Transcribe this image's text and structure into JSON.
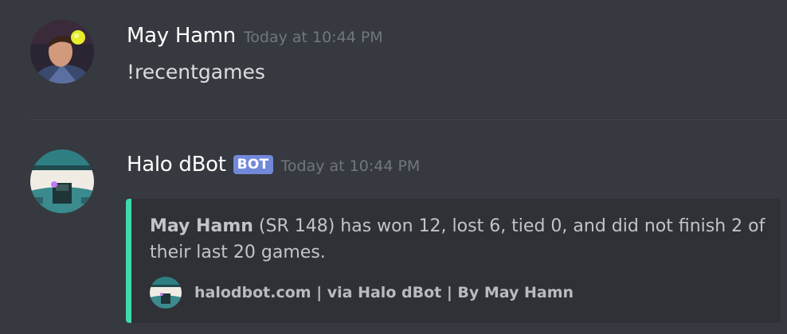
{
  "messages": [
    {
      "author": "May Hamn",
      "timestamp": "Today at 10:44 PM",
      "text": "!recentgames"
    },
    {
      "author": "Halo dBot",
      "badge": "BOT",
      "timestamp": "Today at 10:44 PM",
      "embed": {
        "accent_color": "#3fd9ae",
        "player": "May Hamn",
        "description": " (SR 148) has won 12, lost 6, tied 0, and did not finish 2 of their last 20 games.",
        "footer": "halodbot.com | via Halo dBot | By May Hamn"
      }
    }
  ],
  "colors": {
    "background": "#36393f",
    "embed_background": "#2f3136",
    "bot_badge": "#7289da",
    "timestamp": "#72767d"
  },
  "icons": {
    "user_avatar": "avatar-portrait-icon",
    "bot_avatar": "halo-helmet-icon",
    "footer_icon": "halo-helmet-icon"
  }
}
